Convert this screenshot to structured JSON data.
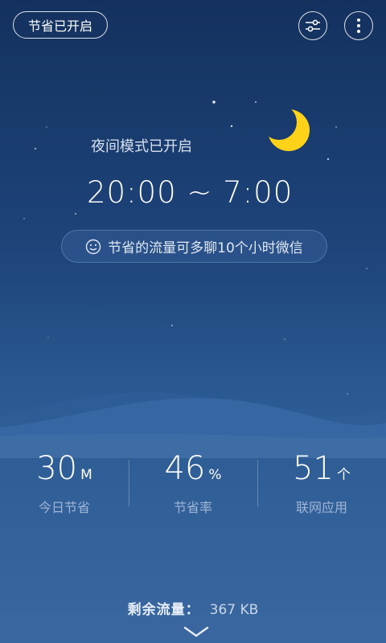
{
  "header": {
    "status_button": "节省已开启",
    "settings_icon": "sliders-icon",
    "more_icon": "more-vertical-icon"
  },
  "night_mode": {
    "label": "夜间模式已开启",
    "time_range": "20:00 ~ 7:00",
    "moon_icon": "crescent-moon-icon"
  },
  "tip": {
    "icon": "smiley-icon",
    "text": "节省的流量可多聊10个小时微信"
  },
  "stats": [
    {
      "value": "30",
      "unit": "M",
      "label": "今日节省"
    },
    {
      "value": "46",
      "unit": "%",
      "label": "节省率"
    },
    {
      "value": "51",
      "unit": "个",
      "label": "联网应用"
    }
  ],
  "remaining": {
    "label": "剩余流量：",
    "value": "367 KB"
  },
  "colors": {
    "sky_top": "#14315e",
    "sky_bottom": "#3a679f",
    "moon": "#ffd21a",
    "muted_label": "#9fb6d6"
  }
}
